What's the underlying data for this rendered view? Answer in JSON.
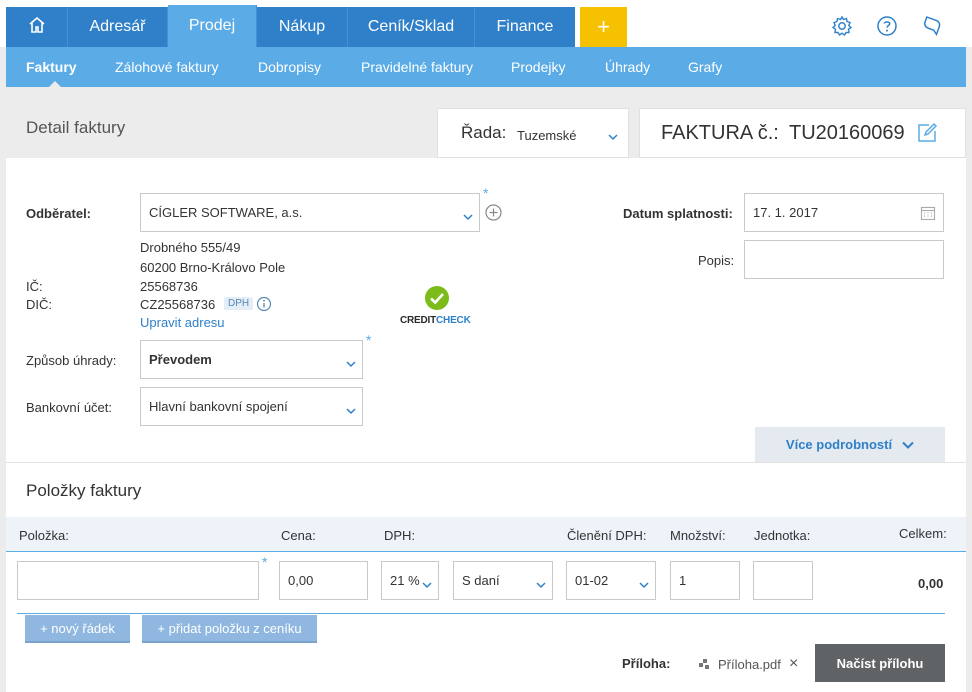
{
  "topnav": {
    "items": [
      {
        "label": ""
      },
      {
        "label": "Adresář"
      },
      {
        "label": "Prodej"
      },
      {
        "label": "Nákup"
      },
      {
        "label": "Ceník/Sklad"
      },
      {
        "label": "Finance"
      }
    ],
    "plus_label": "+"
  },
  "subnav": {
    "items": [
      "Faktury",
      "Zálohové faktury",
      "Dobropisy",
      "Pravidelné faktury",
      "Prodejky",
      "Úhrady",
      "Grafy"
    ]
  },
  "header": {
    "title": "Detail faktury",
    "rada_label": "Řada:",
    "rada_value": "Tuzemské",
    "faktura_label": "FAKTURA č.:",
    "faktura_number": "TU20160069"
  },
  "form": {
    "odberatel_label": "Odběratel:",
    "odberatel_value": "CÍGLER SOFTWARE, a.s.",
    "address_line1": "Drobného 555/49",
    "address_line2": "60200 Brno-Královo Pole",
    "ic_label": "IČ:",
    "ic_value": "25568736",
    "dic_label": "DIČ:",
    "dic_value": "CZ25568736",
    "dph_badge": "DPH",
    "edit_address": "Upravit adresu",
    "creditcheck_a": "CREDIT",
    "creditcheck_b": "CHECK",
    "zpusob_label": "Způsob úhrady:",
    "zpusob_value": "Převodem",
    "ucet_label": "Bankovní účet:",
    "ucet_value": "Hlavní bankovní spojení",
    "splatnost_label": "Datum splatnosti:",
    "splatnost_value": "17. 1. 2017",
    "popis_label": "Popis:",
    "popis_value": "",
    "more_details": "Více podrobností",
    "required_mark": "*"
  },
  "items": {
    "title": "Položky faktury",
    "headers": [
      "Položka:",
      "Cena:",
      "DPH:",
      "Členění DPH:",
      "Množství:",
      "Jednotka:",
      "Celkem:"
    ],
    "row": {
      "polozka": "",
      "cena": "0,00",
      "dph": "21 %",
      "typ": "S daní",
      "cleneni": "01-02",
      "mnozstvi": "1",
      "jednotka": "",
      "celkem": "0,00"
    },
    "new_row": "+ nový řádek",
    "add_from_pricelist": "+ přidat položku z ceníku"
  },
  "attachment": {
    "label": "Příloha:",
    "file": "Příloha.pdf",
    "remove": "×",
    "load_button": "Načíst přílohu"
  },
  "colors": {
    "primary": "#2f80c9",
    "secondary": "#5aabe6",
    "accent": "#f6c100",
    "check_green": "#7cbb1a"
  }
}
